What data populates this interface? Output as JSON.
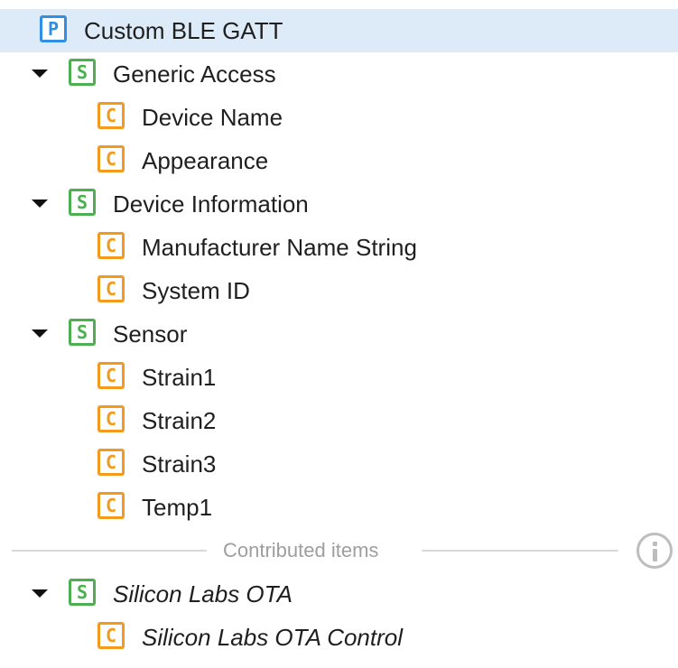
{
  "tree": {
    "root": {
      "badge": "P",
      "label": "Custom BLE GATT"
    },
    "services": [
      {
        "badge": "S",
        "label": "Generic Access",
        "characteristics": [
          {
            "badge": "C",
            "label": "Device Name"
          },
          {
            "badge": "C",
            "label": "Appearance"
          }
        ]
      },
      {
        "badge": "S",
        "label": "Device Information",
        "characteristics": [
          {
            "badge": "C",
            "label": "Manufacturer Name String"
          },
          {
            "badge": "C",
            "label": "System ID"
          }
        ]
      },
      {
        "badge": "S",
        "label": "Sensor",
        "characteristics": [
          {
            "badge": "C",
            "label": "Strain1"
          },
          {
            "badge": "C",
            "label": "Strain2"
          },
          {
            "badge": "C",
            "label": "Strain3"
          },
          {
            "badge": "C",
            "label": "Temp1"
          }
        ]
      }
    ],
    "contributed_label": "Contributed items",
    "contributed": [
      {
        "badge": "S",
        "label": "Silicon Labs OTA",
        "characteristics": [
          {
            "badge": "C",
            "label": "Silicon Labs OTA Control"
          }
        ]
      }
    ]
  },
  "colors": {
    "selection": "#dcebf7",
    "profile_badge": "#2f8ee5",
    "service_badge": "#4caf50",
    "characteristic_badge": "#f39a1c",
    "divider": "#d9d9d9"
  }
}
